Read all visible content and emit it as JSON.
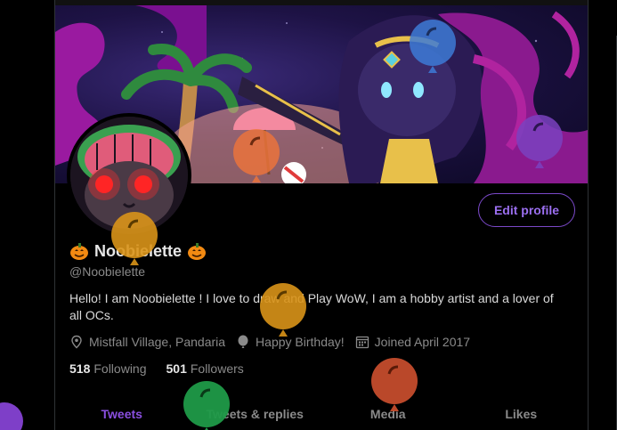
{
  "profile": {
    "display_name": "Noobielette",
    "handle": "@Noobielette",
    "bio": "Hello! I am Noobielette ! I love to draw and Play WoW, I am a hobby artist and a lover of all OCs.",
    "location": "Mistfall Village, Pandaria",
    "birthday": "Happy Birthday!",
    "joined": "Joined April 2017",
    "following_count": "518",
    "following_label": "Following",
    "followers_count": "501",
    "followers_label": "Followers",
    "edit_label": "Edit profile"
  },
  "tabs": [
    {
      "label": "Tweets"
    },
    {
      "label": "Tweets & replies"
    },
    {
      "label": "Media"
    },
    {
      "label": "Likes"
    }
  ],
  "colors": {
    "accent": "#8a4fe0",
    "background": "#000000",
    "muted_text": "#8a8a8a"
  },
  "icons": [
    "pumpkin-icon",
    "location-icon",
    "balloon-icon",
    "calendar-icon"
  ]
}
